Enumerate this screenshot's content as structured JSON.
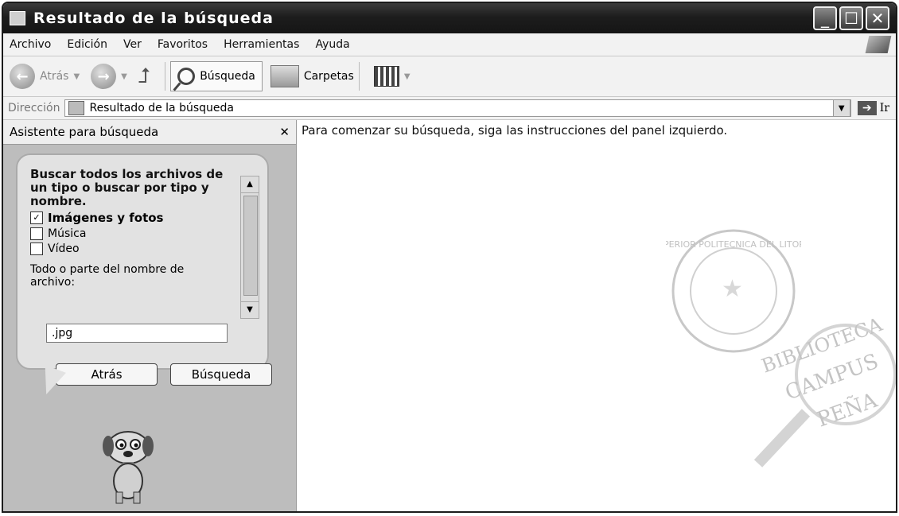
{
  "window": {
    "title": "Resultado de la búsqueda",
    "controls": {
      "minimize": "_",
      "maximize": "☐",
      "close": "✕"
    }
  },
  "menubar": {
    "items": [
      "Archivo",
      "Edición",
      "Ver",
      "Favoritos",
      "Herramientas",
      "Ayuda"
    ]
  },
  "toolbar": {
    "back_label": "Atrás",
    "search_label": "Búsqueda",
    "folders_label": "Carpetas"
  },
  "address_bar": {
    "label": "Dirección",
    "value": "Resultado de la búsqueda",
    "go_label": "Ir"
  },
  "search_pane": {
    "title": "Asistente para búsqueda",
    "heading": "Buscar todos los archivos de un tipo o buscar por tipo y nombre.",
    "options": [
      {
        "label": "Imágenes y fotos",
        "checked": true
      },
      {
        "label": "Música",
        "checked": false
      },
      {
        "label": "Vídeo",
        "checked": false
      }
    ],
    "filename_label": "Todo o parte del nombre de archivo:",
    "filename_value": ".jpg",
    "back_button": "Atrás",
    "search_button": "Búsqueda"
  },
  "main": {
    "message": "Para comenzar su búsqueda, siga las instrucciones del panel izquierdo."
  },
  "watermark": {
    "seal_text": "SUPERIOR POLITECNICA DEL LITORAL",
    "stamp_lines": [
      "BIBLIOTECA",
      "CAMPUS",
      "PEÑA"
    ]
  }
}
